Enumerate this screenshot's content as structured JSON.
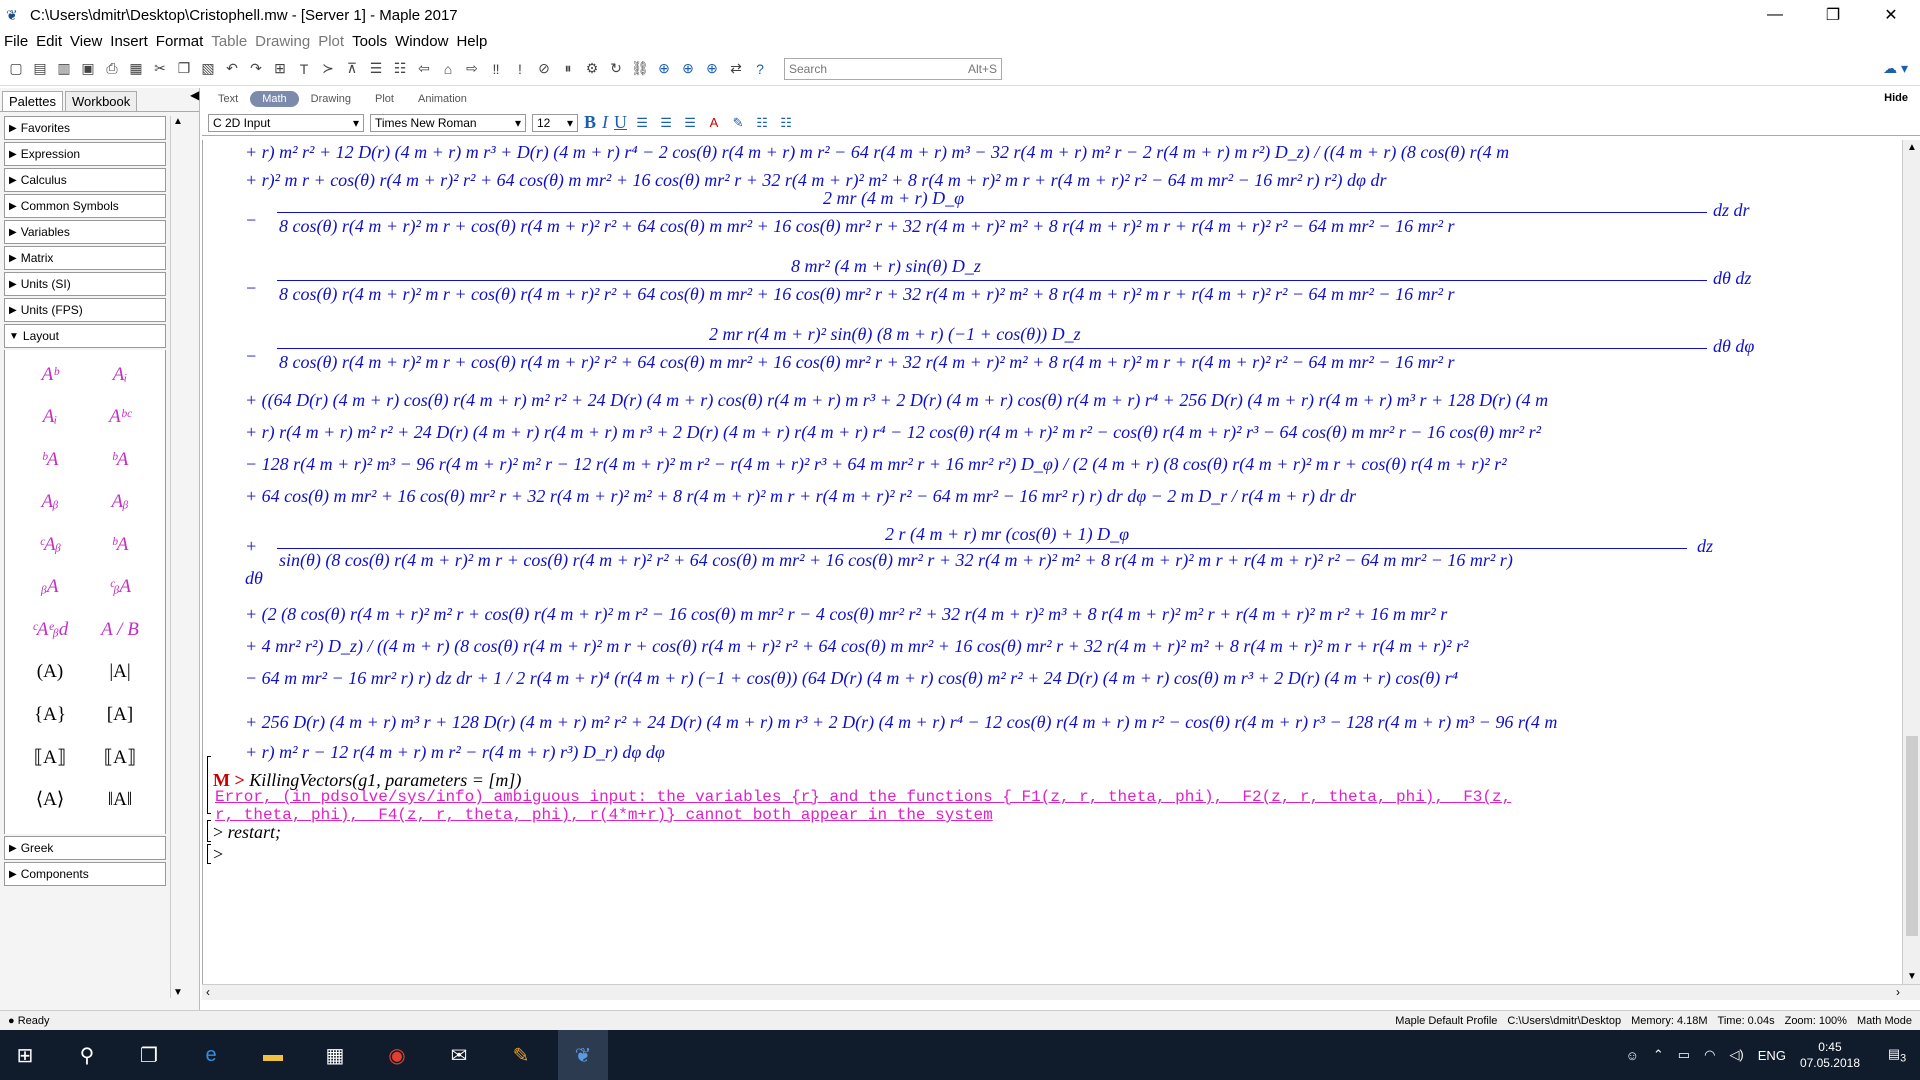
{
  "window": {
    "title": "C:\\Users\\dmitr\\Desktop\\Cristophell.mw - [Server 1] - Maple 2017",
    "minimize": "—",
    "maximize": "❐",
    "close": "✕"
  },
  "menu": [
    "File",
    "Edit",
    "View",
    "Insert",
    "Format",
    "Table",
    "Drawing",
    "Plot",
    "Tools",
    "Window",
    "Help"
  ],
  "menu_disabled": [
    "Table",
    "Drawing",
    "Plot"
  ],
  "search": {
    "placeholder": "Search",
    "shortcut": "Alt+S"
  },
  "sidebar": {
    "tabs": [
      "Palettes",
      "Workbook"
    ],
    "palettes_top": [
      "Favorites",
      "Expression",
      "Calculus",
      "Common Symbols",
      "Variables",
      "Matrix",
      "Units (SI)",
      "Units (FPS)",
      "Layout"
    ],
    "palettes_bottom": [
      "Greek",
      "Components"
    ],
    "layout_items": [
      "Aᵇ",
      "Aᵢ",
      "Aᵢ",
      "Aᵇᶜ",
      "ᵇA",
      "ᵇA",
      "Aᵦ",
      "Aᵦ",
      "ᶜAᵦ",
      "ᵇA",
      "ᵦA",
      "ᶜᵦA",
      "ᶜAᵉᵦd",
      "A / B",
      "(A)",
      "|A|",
      "{A}",
      "[A]",
      "⟦A⟧",
      "⟦A⟧",
      "⟨A⟩",
      "‖A‖"
    ]
  },
  "modes": {
    "items": [
      "Text",
      "Math",
      "Drawing",
      "Plot",
      "Animation"
    ],
    "active": "Math",
    "hide": "Hide"
  },
  "format": {
    "input_mode": "C 2D Input",
    "font": "Times New Roman",
    "size": "12"
  },
  "math_lines": [
    "+ r) m² r² + 12 D(r) (4 m + r) m r³ + D(r) (4 m + r) r⁴ − 2 cos(θ) r(4 m + r) m r² − 64 r(4 m + r) m³ − 32 r(4 m + r) m² r − 2 r(4 m + r) m r²) D_z) / ((4 m + r) (8 cos(θ) r(4 m",
    "+ r)² m r + cos(θ) r(4 m + r)² r² + 64 cos(θ) m mr² + 16 cos(θ) mr² r + 32 r(4 m + r)² m² + 8 r(4 m + r)² m r + r(4 m + r)² r² − 64 m mr² − 16 mr² r) r²) dφ dr",
    "+ ((64 D(r) (4 m + r) cos(θ) r(4 m + r) m² r² + 24 D(r) (4 m + r) cos(θ) r(4 m + r) m r³ + 2 D(r) (4 m + r) cos(θ) r(4 m + r) r⁴ + 256 D(r) (4 m + r) r(4 m + r) m³ r + 128 D(r) (4 m",
    "+ r) r(4 m + r) m² r² + 24 D(r) (4 m + r) r(4 m + r) m r³ + 2 D(r) (4 m + r) r(4 m + r) r⁴ − 12 cos(θ) r(4 m + r)² m r² − cos(θ) r(4 m + r)² r³ − 64 cos(θ) m mr² r − 16 cos(θ) mr² r²",
    "− 128 r(4 m + r)² m³ − 96 r(4 m + r)² m² r − 12 r(4 m + r)² m r² − r(4 m + r)² r³ + 64 m mr² r + 16 mr² r²) D_φ) / (2 (4 m + r) (8 cos(θ) r(4 m + r)² m r + cos(θ) r(4 m + r)² r²",
    "+ 64 cos(θ) m mr² + 16 cos(θ) mr² r + 32 r(4 m + r)² m² + 8 r(4 m + r)² m r + r(4 m + r)² r² − 64 m mr² − 16 mr² r) r) dr dφ − 2 m D_r / r(4 m + r) dr dr",
    "dθ",
    "+ (2 (8 cos(θ) r(4 m + r)² m² r + cos(θ) r(4 m + r)² m r² − 16 cos(θ) m mr² r − 4 cos(θ) mr² r² + 32 r(4 m + r)² m³ + 8 r(4 m + r)² m² r + r(4 m + r)² m r² + 16 m mr² r",
    "+ 4 mr² r²) D_z) / ((4 m + r) (8 cos(θ) r(4 m + r)² m r + cos(θ) r(4 m + r)² r² + 64 cos(θ) m mr² + 16 cos(θ) mr² r + 32 r(4 m + r)² m² + 8 r(4 m + r)² m r + r(4 m + r)² r²",
    "− 64 m mr² − 16 mr² r) r) dz dr + 1 / 2 r(4 m + r)⁴ (r(4 m + r) (−1 + cos(θ)) (64 D(r) (4 m + r) cos(θ) m² r² + 24 D(r) (4 m + r) cos(θ) m r³ + 2 D(r) (4 m + r) cos(θ) r⁴",
    "+ 256 D(r) (4 m + r) m³ r + 128 D(r) (4 m + r) m² r² + 24 D(r) (4 m + r) m r³ + 2 D(r) (4 m + r) r⁴ − 12 cos(θ) r(4 m + r) m r² − cos(θ) r(4 m + r) r³ − 128 r(4 m + r) m³ − 96 r(4 m",
    "+ r) m² r − 12 r(4 m + r) m r² − r(4 m + r) r³) D_r) dφ dφ"
  ],
  "fractions": [
    {
      "sign": "−",
      "num": "2 mr (4 m + r) D_φ",
      "den": "8 cos(θ) r(4 m + r)² m r + cos(θ) r(4 m + r)² r² + 64 cos(θ) m mr² + 16 cos(θ) mr² r + 32 r(4 m + r)² m² + 8 r(4 m + r)² m r + r(4 m + r)² r² − 64 m mr² − 16 mr² r",
      "tail": "dz dr"
    },
    {
      "sign": "−",
      "num": "8 mr² (4 m + r) sin(θ) D_z",
      "den": "8 cos(θ) r(4 m + r)² m r + cos(θ) r(4 m + r)² r² + 64 cos(θ) m mr² + 16 cos(θ) mr² r + 32 r(4 m + r)² m² + 8 r(4 m + r)² m r + r(4 m + r)² r² − 64 m mr² − 16 mr² r",
      "tail": "dθ dz"
    },
    {
      "sign": "−",
      "num": "2 mr r(4 m + r)² sin(θ) (8 m + r) (−1 + cos(θ)) D_z",
      "den": "8 cos(θ) r(4 m + r)² m r + cos(θ) r(4 m + r)² r² + 64 cos(θ) m mr² + 16 cos(θ) mr² r + 32 r(4 m + r)² m² + 8 r(4 m + r)² m r + r(4 m + r)² r² − 64 m mr² − 16 mr² r",
      "tail": "dθ dφ"
    },
    {
      "sign": "+",
      "num": "2 r (4 m + r) mr (cos(θ) + 1) D_φ",
      "den": "sin(θ) (8 cos(θ) r(4 m + r)² m r + cos(θ) r(4 m + r)² r² + 64 cos(θ) m mr² + 16 cos(θ) mr² r + 32 r(4 m + r)² m² + 8 r(4 m + r)² m r + r(4 m + r)² r² − 64 m mr² − 16 mr² r)",
      "tail": "dz"
    }
  ],
  "commands": {
    "cmd1_prompt": "M >",
    "cmd1": "KillingVectors(g1, parameters = [m])",
    "error1": "Error, (in pdsolve/sys/info) ambiguous input: the variables {r} and the functions {_F1(z, r, theta, phi), _F2(z, r, theta, phi), _F3(z,",
    "error2": "r, theta, phi), _F4(z, r, theta, phi), r(4*m+r)} cannot both appear in the system",
    "cmd2_prompt": ">",
    "cmd2": "restart;",
    "cmd3_prompt": ">"
  },
  "status": {
    "ready": "Ready",
    "profile": "Maple Default Profile",
    "path": "C:\\Users\\dmitr\\Desktop",
    "memory": "Memory: 4.18M",
    "time": "Time: 0.04s",
    "zoom": "Zoom: 100%",
    "mode": "Math Mode"
  },
  "taskbar": {
    "time": "0:45",
    "date": "07.05.2018",
    "lang": "ENG",
    "notifications": "3"
  },
  "colors": {
    "math": "#1010c8",
    "error": "#e021c8",
    "taskbar": "#101b2b"
  }
}
